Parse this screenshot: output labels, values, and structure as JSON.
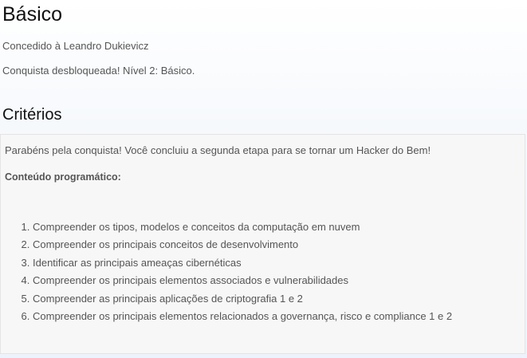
{
  "badge": {
    "title": "Básico",
    "awarded_to": "Concedido à Leandro Dukievicz",
    "unlocked": "Conquista desbloqueada! Nível 2: Básico."
  },
  "criteria": {
    "title": "Critérios",
    "intro": "Parabéns pela conquista! Você concluiu a segunda etapa para se tornar um Hacker do Bem!",
    "syllabus_label": "Conteúdo programático:",
    "items": [
      "Compreender os tipos, modelos e conceitos da computação em nuvem",
      "Compreender os principais conceitos de desenvolvimento",
      "Identificar as principais ameaças cibernéticas",
      "Compreender os principais elementos associados e vulnerabilidades",
      "Compreender as principais aplicações de criptografia 1 e 2",
      "Compreender os principais elementos relacionados a governança, risco e compliance 1 e 2"
    ]
  }
}
